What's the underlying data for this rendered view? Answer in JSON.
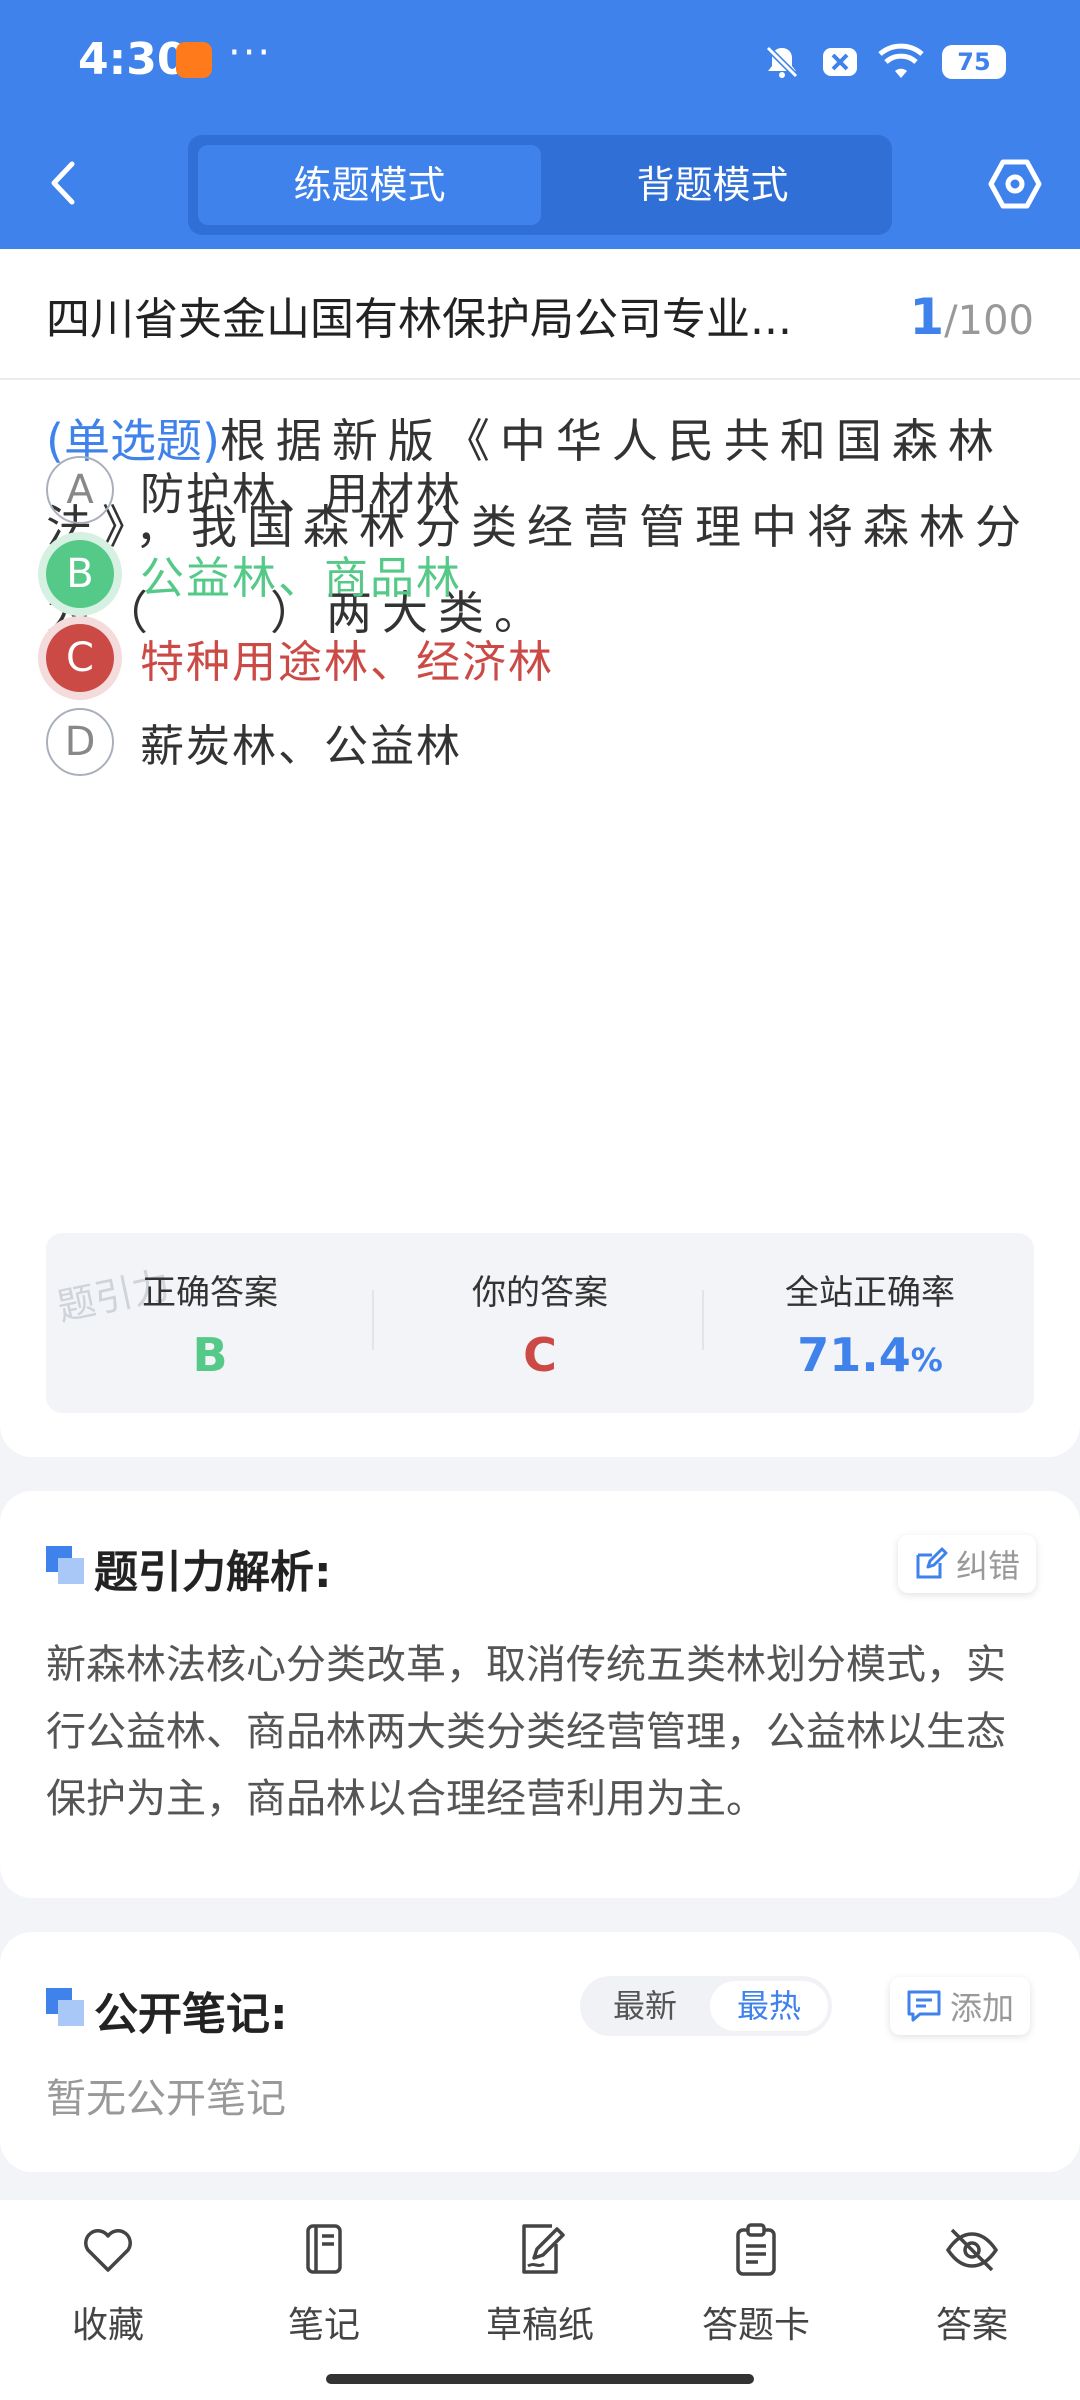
{
  "status_bar": {
    "time": "4:30",
    "more": "···",
    "battery": "75"
  },
  "header": {
    "tabs": [
      {
        "label": "练题模式",
        "active": true
      },
      {
        "label": "背题模式",
        "active": false
      }
    ]
  },
  "question": {
    "title": "四川省夹金山国有林保护局公司专业...",
    "current": "1",
    "total": "/100",
    "type": "(单选题)",
    "text": "根据新版《中华人民共和国森林法》，我国森林分类经营管理中将森林分为（　　）两大类。",
    "options": [
      {
        "letter": "A",
        "text": "防护林、用材林",
        "state": "normal"
      },
      {
        "letter": "B",
        "text": "公益林、商品林",
        "state": "correct"
      },
      {
        "letter": "C",
        "text": "特种用途林、经济林",
        "state": "wrong"
      },
      {
        "letter": "D",
        "text": "薪炭林、公益林",
        "state": "normal"
      }
    ]
  },
  "result": {
    "watermark": "题引力",
    "correct_label": "正确答案",
    "correct_value": "B",
    "yours_label": "你的答案",
    "yours_value": "C",
    "rate_label": "全站正确率",
    "rate_value": "71.4",
    "rate_unit": "%"
  },
  "analysis": {
    "title": "题引力解析:",
    "report_label": "纠错",
    "text": "新森林法核心分类改革，取消传统五类林划分模式，实行公益林、商品林两大类分类经营管理，公益林以生态保护为主，商品林以合理经营利用为主。"
  },
  "notes": {
    "title": "公开笔记:",
    "sort_latest": "最新",
    "sort_hot": "最热",
    "add_label": "添加",
    "empty": "暂无公开笔记"
  },
  "bottom_nav": [
    {
      "label": "收藏",
      "icon": "heart-icon"
    },
    {
      "label": "笔记",
      "icon": "notebook-icon"
    },
    {
      "label": "草稿纸",
      "icon": "draft-icon"
    },
    {
      "label": "答题卡",
      "icon": "answer-sheet-icon"
    },
    {
      "label": "答案",
      "icon": "eye-off-icon"
    }
  ],
  "colors": {
    "primary": "#3f82ec",
    "correct": "#55c987",
    "wrong": "#cc4a46"
  }
}
